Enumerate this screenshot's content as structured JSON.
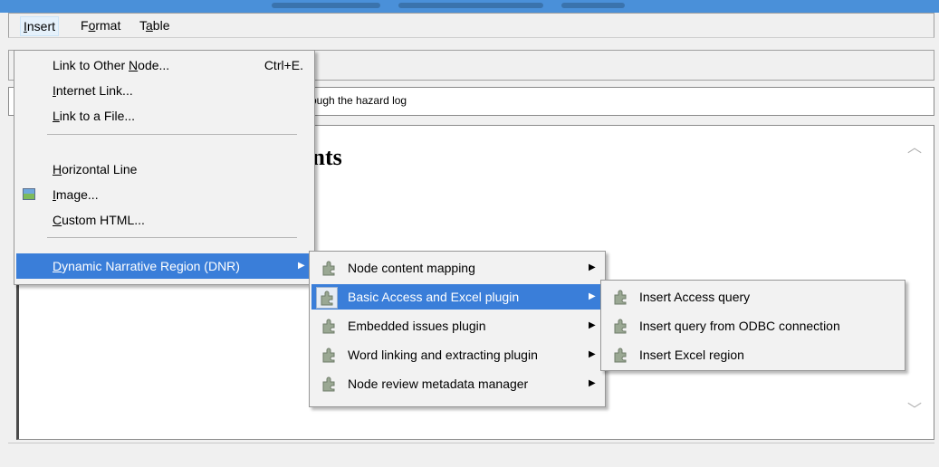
{
  "menubar": {
    "items": [
      {
        "pre": "",
        "u": "I",
        "post": "nsert"
      },
      {
        "pre": "F",
        "u": "o",
        "post": "rmat"
      },
      {
        "pre": "T",
        "u": "a",
        "post": "ble"
      }
    ]
  },
  "subject_text": "ly through the hazard log",
  "editor_heading": "ents",
  "insert_menu": {
    "items": [
      {
        "pre": "Link to Other ",
        "u": "N",
        "post": "ode...",
        "shortcut": "Ctrl+E."
      },
      {
        "pre": "",
        "u": "I",
        "post": "nternet Link..."
      },
      {
        "pre": "",
        "u": "L",
        "post": "ink to a File..."
      },
      {
        "pre": "",
        "u": "H",
        "post": "orizontal Line"
      },
      {
        "pre": "",
        "u": "I",
        "post": "mage..."
      },
      {
        "pre": "",
        "u": "C",
        "post": "ustom HTML..."
      },
      {
        "pre": "",
        "u": "D",
        "post": "ynamic Narrative Region (DNR)"
      }
    ]
  },
  "dnr_menu": {
    "items": [
      {
        "label": "Node content mapping"
      },
      {
        "label": "Basic Access and Excel plugin"
      },
      {
        "label": "Embedded issues plugin"
      },
      {
        "label": "Word linking and extracting plugin"
      },
      {
        "label": "Node review metadata manager"
      }
    ]
  },
  "excel_menu": {
    "items": [
      {
        "label": "Insert Access query"
      },
      {
        "label": "Insert query from ODBC connection"
      },
      {
        "label": "Insert Excel region"
      }
    ]
  },
  "icons": {
    "submenu_arrow": "▶",
    "scroll_up": "︿",
    "scroll_down": "﹀"
  },
  "colors": {
    "highlight": "#3a7ed9",
    "menu_bg": "#f2f2f2"
  }
}
